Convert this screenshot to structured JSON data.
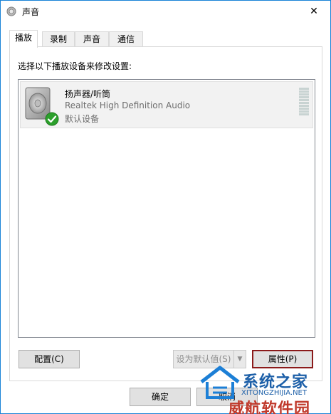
{
  "window": {
    "title": "声音",
    "close_glyph": "✕"
  },
  "tabs": [
    {
      "label": "播放",
      "active": true
    },
    {
      "label": "录制",
      "active": false
    },
    {
      "label": "声音",
      "active": false
    },
    {
      "label": "通信",
      "active": false
    }
  ],
  "panel": {
    "instruction": "选择以下播放设备来修改设置:"
  },
  "device": {
    "name": "扬声器/听筒",
    "driver": "Realtek High Definition Audio",
    "status": "默认设备",
    "icon": "speaker-icon",
    "badge_icon": "default-check-icon"
  },
  "buttons": {
    "configure": "配置(C)",
    "set_default": "设为默认值(S)",
    "set_default_arrow": "▼",
    "properties": "属性(P)",
    "ok": "确定",
    "cancel": "取消"
  },
  "watermark": {
    "line1": "系统之家",
    "line2": "XITONGZHIJIA.NET",
    "line3": "威航软件园"
  },
  "colors": {
    "accent": "#1883d7",
    "focus_border": "#8b1a1a",
    "check_green": "#2ca02c",
    "watermark_red": "#c0392b"
  }
}
